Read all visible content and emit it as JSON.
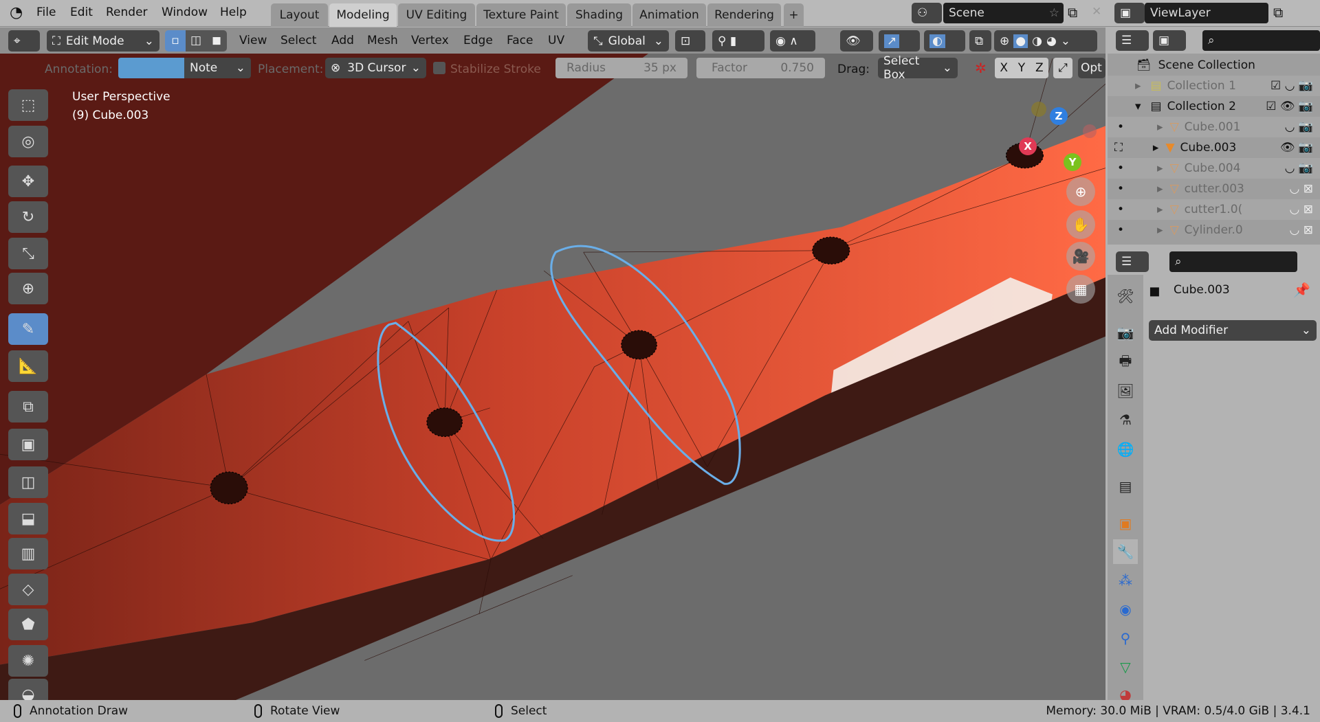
{
  "topbar": {
    "menus": [
      "File",
      "Edit",
      "Render",
      "Window",
      "Help"
    ],
    "tabs": [
      "Layout",
      "Modeling",
      "UV Editing",
      "Texture Paint",
      "Shading",
      "Animation",
      "Rendering",
      "+"
    ],
    "active_tab": "Modeling",
    "scene": "Scene",
    "view_layer": "ViewLayer"
  },
  "header": {
    "mode": "Edit Mode",
    "menus": [
      "View",
      "Select",
      "Add",
      "Mesh",
      "Vertex",
      "Edge",
      "Face",
      "UV"
    ],
    "orientation": "Global"
  },
  "tool_settings": {
    "annotation_label": "Annotation:",
    "annotation_color": "#5b9bd0",
    "note": "Note",
    "placement_label": "Placement:",
    "placement": "3D Cursor",
    "stabilize": "Stabilize Stroke",
    "radius_label": "Radius",
    "radius_value": "35 px",
    "factor_label": "Factor",
    "factor_value": "0.750",
    "drag_label": "Drag:",
    "drag": "Select Box",
    "axes": [
      "X",
      "Y",
      "Z"
    ],
    "options": "Opt"
  },
  "viewport": {
    "view_name": "User Perspective",
    "object_info": "(9) Cube.003",
    "gizmo": {
      "x": "X",
      "y": "Y",
      "z": "Z"
    }
  },
  "tools": [
    "select-box",
    "cursor",
    "move",
    "rotate",
    "scale",
    "transform",
    "annotate",
    "measure",
    "add-cube",
    "extrude",
    "inset",
    "bevel",
    "loop-cut",
    "knife",
    "poly-build",
    "spin",
    "smooth"
  ],
  "outliner": {
    "rows": [
      {
        "name": "Scene Collection",
        "level": 0
      },
      {
        "name": "Collection 1",
        "level": 1,
        "dim": true
      },
      {
        "name": "Collection 2",
        "level": 1
      },
      {
        "name": "Cube.001",
        "level": 2,
        "dim": true
      },
      {
        "name": "Cube.003",
        "level": 2,
        "active": true
      },
      {
        "name": "Cube.004",
        "level": 2,
        "dim": true
      },
      {
        "name": "cutter.003",
        "level": 2,
        "dim": true
      },
      {
        "name": "cutter1.0(",
        "level": 2,
        "dim": true
      },
      {
        "name": "Cylinder.0",
        "level": 2,
        "dim": true
      }
    ]
  },
  "properties": {
    "object": "Cube.003",
    "add_modifier": "Add Modifier"
  },
  "status": {
    "left": "Annotation Draw",
    "middle": "Rotate View",
    "right": "Select",
    "info": "Memory: 30.0 MiB | VRAM: 0.5/4.0 GiB | 3.4.1"
  }
}
